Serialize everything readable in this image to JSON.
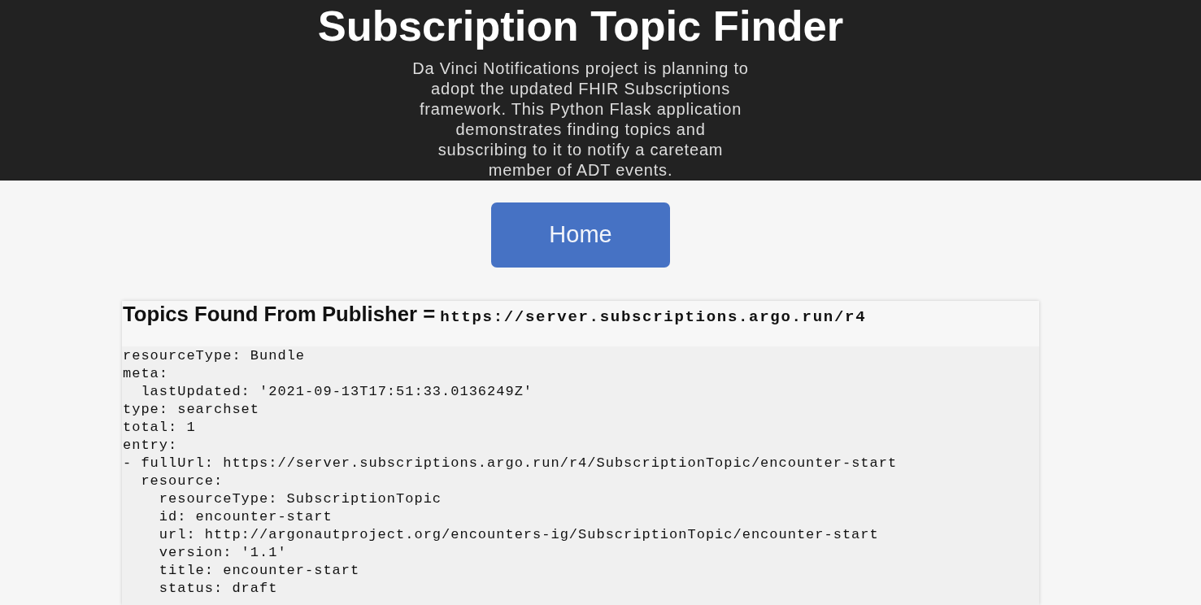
{
  "header": {
    "title": "Subscription Topic Finder",
    "description": "Da Vinci Notifications project is planning to adopt the updated FHIR Subscriptions framework. This Python Flask application demonstrates finding topics and subscribing to it to notify a careteam member of ADT events."
  },
  "nav": {
    "home_button": "Home"
  },
  "results": {
    "heading": "Topics Found From Publisher =",
    "publisher_url": "https://server.subscriptions.argo.run/r4",
    "lines": [
      {
        "text": "resourceType: Bundle"
      },
      {
        "text": "meta:",
        "children": [
          {
            "text": "lastUpdated: '2021-09-13T17:51:33.0136249Z'"
          }
        ]
      },
      {
        "text": "type: searchset"
      },
      {
        "text": "total: 1"
      },
      {
        "text": "entry:"
      },
      {
        "text": "- fullUrl: https://server.subscriptions.argo.run/r4/SubscriptionTopic/encounter-start",
        "children": [
          {
            "text": "resource:",
            "children": [
              {
                "text": "resourceType: SubscriptionTopic"
              },
              {
                "text": "id: encounter-start"
              },
              {
                "text": "url: http://argonautproject.org/encounters-ig/SubscriptionTopic/encounter-start"
              },
              {
                "text": "version: '1.1'"
              },
              {
                "text": "title: encounter-start"
              },
              {
                "text": "status: draft"
              }
            ]
          }
        ]
      }
    ]
  }
}
